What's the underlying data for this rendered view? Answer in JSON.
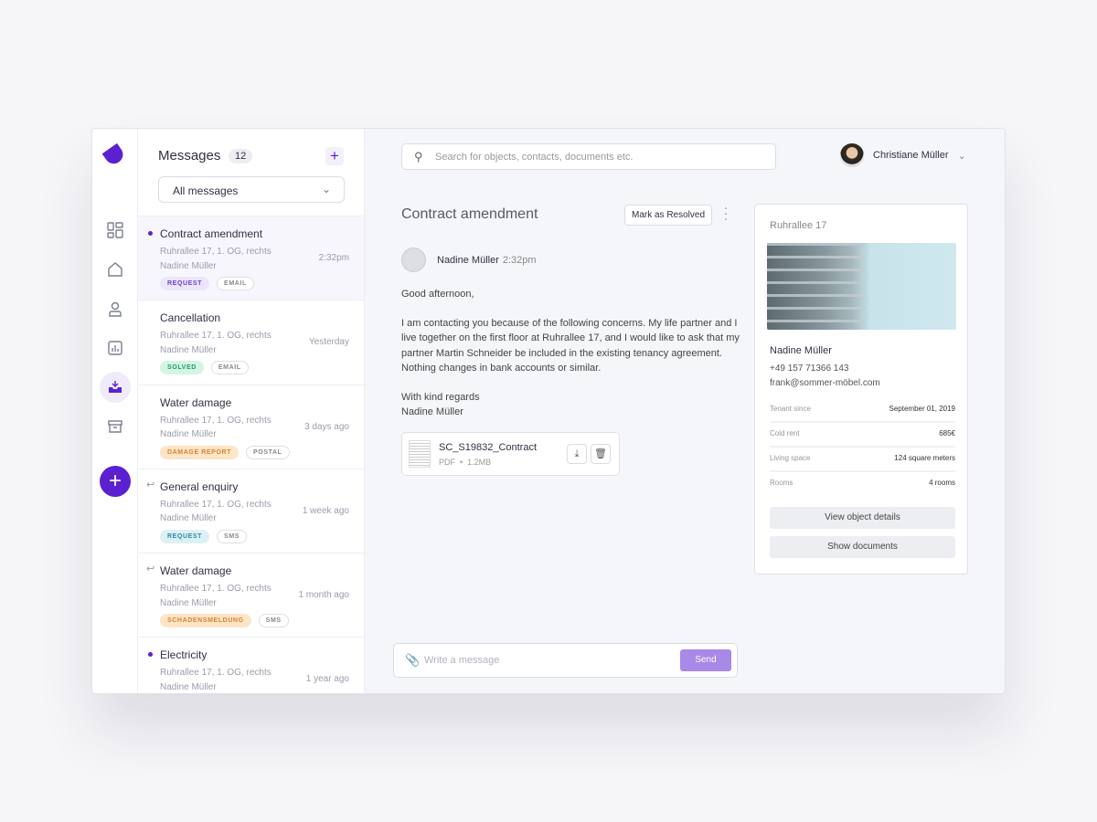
{
  "sidebar": {
    "nav": [
      "dashboard-icon",
      "home-icon",
      "user-icon",
      "chart-icon",
      "inbox-icon",
      "archive-icon"
    ],
    "active": "inbox-icon",
    "accent": "#5b21d1"
  },
  "list": {
    "title": "Messages",
    "count": "12",
    "filter": "All messages",
    "items": [
      {
        "title": "Contract amendment",
        "address": "Ruhrallee 17, 1. OG, rechts",
        "name": "Nadine Müller",
        "time": "2:32pm",
        "tag": "REQUEST",
        "channel": "EMAIL"
      },
      {
        "title": "Cancellation",
        "address": "Ruhrallee 17, 1. OG, rechts",
        "name": "Nadine Müller",
        "time": "Yesterday",
        "tag": "SOLVED",
        "channel": "EMAIL"
      },
      {
        "title": "Water damage",
        "address": "Ruhrallee 17, 1. OG, rechts",
        "name": "Nadine Müller",
        "time": "3 days ago",
        "tag": "DAMAGE REPORT",
        "channel": "POSTAL"
      },
      {
        "title": "General enquiry",
        "address": "Ruhrallee 17, 1. OG, rechts",
        "name": "Nadine Müller",
        "time": "1 week ago",
        "tag": "REQUEST",
        "channel": "SMS"
      },
      {
        "title": "Water damage",
        "address": "Ruhrallee 17, 1. OG, rechts",
        "name": "Nadine Müller",
        "time": "1 month ago",
        "tag": "SCHADENSMELDUNG",
        "channel": "SMS"
      },
      {
        "title": "Electricity",
        "address": "Ruhrallee 17, 1. OG, rechts",
        "name": "Nadine Müller",
        "time": "1 year ago"
      }
    ]
  },
  "header": {
    "search_placeholder": "Search for objects, contacts, documents etc.",
    "user": "Christiane Müller"
  },
  "message": {
    "title": "Contract amendment",
    "resolve": "Mark as Resolved",
    "sender": "Nadine Müller",
    "time": "2:32pm",
    "greeting": "Good afternoon,",
    "body": "I am contacting you because of the following concerns. My life partner and I live together on the first floor at Ruhrallee 17, and I would like to ask that my partner Martin Schneider be included in the existing tenancy agreement. Nothing changes in bank accounts or similar.",
    "closing": "With kind regards",
    "signature": "Nadine Müller",
    "attachment": {
      "name": "SC_S19832_Contract",
      "type": "PDF",
      "size": "1.2MB"
    }
  },
  "compose": {
    "placeholder": "Write a message",
    "send": "Send"
  },
  "object": {
    "title": "Ruhrallee 17",
    "tenant": "Nadine Müller",
    "phone": "+49 157 71366 143",
    "email": "frank@sommer-möbel.com",
    "rows": [
      {
        "label": "Tenant since",
        "value": "September 01, 2019"
      },
      {
        "label": "Cold rent",
        "value": "685€"
      },
      {
        "label": "Living space",
        "value": "124 square meters"
      },
      {
        "label": "Rooms",
        "value": "4 rooms"
      }
    ],
    "view_details": "View object details",
    "show_documents": "Show documents"
  }
}
